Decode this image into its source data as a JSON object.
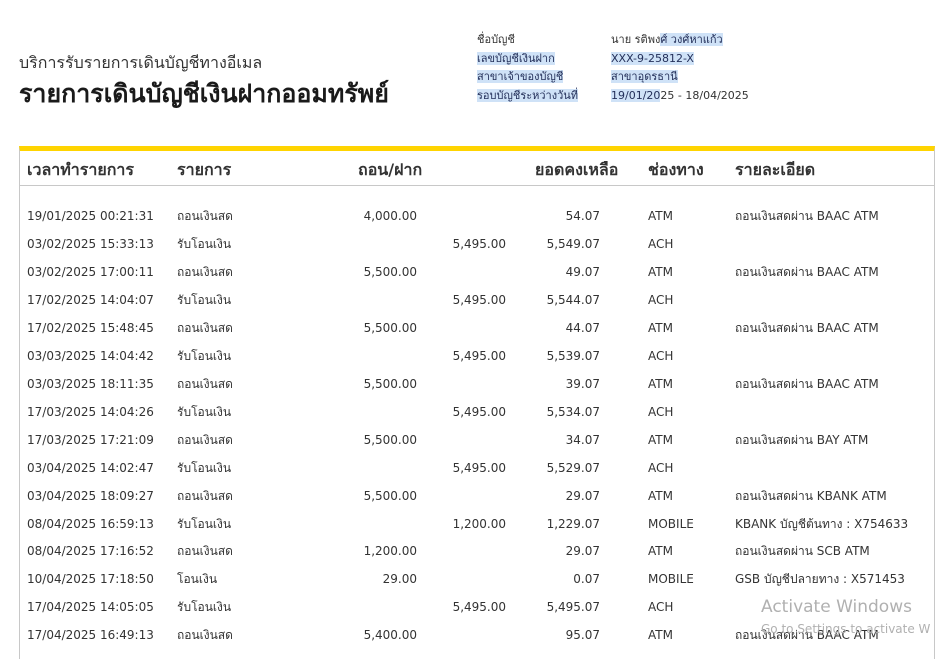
{
  "header": {
    "subtitle": "บริการรับรายการเดินบัญชีทางอีเมล",
    "title": "รายการเดินบัญชีเงินฝากออมทรัพย์"
  },
  "info": {
    "account_name_label": "ชื่อบัญชี",
    "account_name_plain": "นาย รติพง",
    "account_name_highlight": "ศ์ วงศ์หาแก้ว",
    "account_number_label": "เลขบัญชีเงินฝาก",
    "account_number_value": "XXX-9-25812-X",
    "branch_label": "สาขาเจ้าของบัญชี",
    "branch_value": "สาขาอุดรธานี",
    "period_label": "รอบบัญชีระหว่างวันที่",
    "period_highlight": "19/01/20",
    "period_plain": "25 - 18/04/2025"
  },
  "table": {
    "columns": {
      "time": "เวลาทำรายการ",
      "type": "รายการ",
      "amount": "ถอน/ฝาก",
      "balance": "ยอดคงเหลือ",
      "channel": "ช่องทาง",
      "details": "รายละเอียด"
    },
    "rows": [
      {
        "time": "19/01/2025 00:21:31",
        "type": "ถอนเงินสด",
        "withdraw": "4,000.00",
        "deposit": "",
        "balance": "54.07",
        "channel": "ATM",
        "details": "ถอนเงินสดผ่าน BAAC ATM"
      },
      {
        "time": "03/02/2025 15:33:13",
        "type": "รับโอนเงิน",
        "withdraw": "",
        "deposit": "5,495.00",
        "balance": "5,549.07",
        "channel": "ACH",
        "details": ""
      },
      {
        "time": "03/02/2025 17:00:11",
        "type": "ถอนเงินสด",
        "withdraw": "5,500.00",
        "deposit": "",
        "balance": "49.07",
        "channel": "ATM",
        "details": "ถอนเงินสดผ่าน BAAC ATM"
      },
      {
        "time": "17/02/2025 14:04:07",
        "type": "รับโอนเงิน",
        "withdraw": "",
        "deposit": "5,495.00",
        "balance": "5,544.07",
        "channel": "ACH",
        "details": ""
      },
      {
        "time": "17/02/2025 15:48:45",
        "type": "ถอนเงินสด",
        "withdraw": "5,500.00",
        "deposit": "",
        "balance": "44.07",
        "channel": "ATM",
        "details": "ถอนเงินสดผ่าน BAAC ATM"
      },
      {
        "time": "03/03/2025 14:04:42",
        "type": "รับโอนเงิน",
        "withdraw": "",
        "deposit": "5,495.00",
        "balance": "5,539.07",
        "channel": "ACH",
        "details": ""
      },
      {
        "time": "03/03/2025 18:11:35",
        "type": "ถอนเงินสด",
        "withdraw": "5,500.00",
        "deposit": "",
        "balance": "39.07",
        "channel": "ATM",
        "details": "ถอนเงินสดผ่าน BAAC ATM"
      },
      {
        "time": "17/03/2025 14:04:26",
        "type": "รับโอนเงิน",
        "withdraw": "",
        "deposit": "5,495.00",
        "balance": "5,534.07",
        "channel": "ACH",
        "details": ""
      },
      {
        "time": "17/03/2025 17:21:09",
        "type": "ถอนเงินสด",
        "withdraw": "5,500.00",
        "deposit": "",
        "balance": "34.07",
        "channel": "ATM",
        "details": "ถอนเงินสดผ่าน BAY ATM"
      },
      {
        "time": "03/04/2025 14:02:47",
        "type": "รับโอนเงิน",
        "withdraw": "",
        "deposit": "5,495.00",
        "balance": "5,529.07",
        "channel": "ACH",
        "details": ""
      },
      {
        "time": "03/04/2025 18:09:27",
        "type": "ถอนเงินสด",
        "withdraw": "5,500.00",
        "deposit": "",
        "balance": "29.07",
        "channel": "ATM",
        "details": "ถอนเงินสดผ่าน KBANK ATM"
      },
      {
        "time": "08/04/2025 16:59:13",
        "type": "รับโอนเงิน",
        "withdraw": "",
        "deposit": "1,200.00",
        "balance": "1,229.07",
        "channel": "MOBILE",
        "details": "KBANK บัญชีต้นทาง : X754633"
      },
      {
        "time": "08/04/2025 17:16:52",
        "type": "ถอนเงินสด",
        "withdraw": "1,200.00",
        "deposit": "",
        "balance": "29.07",
        "channel": "ATM",
        "details": "ถอนเงินสดผ่าน SCB ATM"
      },
      {
        "time": "10/04/2025 17:18:50",
        "type": "โอนเงิน",
        "withdraw": "29.00",
        "deposit": "",
        "balance": "0.07",
        "channel": "MOBILE",
        "details": "GSB บัญชีปลายทาง : X571453"
      },
      {
        "time": "17/04/2025 14:05:05",
        "type": "รับโอนเงิน",
        "withdraw": "",
        "deposit": "5,495.00",
        "balance": "5,495.07",
        "channel": "ACH",
        "details": ""
      },
      {
        "time": "17/04/2025 16:49:13",
        "type": "ถอนเงินสด",
        "withdraw": "5,400.00",
        "deposit": "",
        "balance": "95.07",
        "channel": "ATM",
        "details": "ถอนเงินสดผ่าน BAAC ATM"
      }
    ]
  },
  "watermark": {
    "line1": "Activate Windows",
    "line2": "Go to Settings to activate W"
  },
  "colors": {
    "accent_bar": "#ffd400",
    "highlight": "#cfe2f7"
  }
}
